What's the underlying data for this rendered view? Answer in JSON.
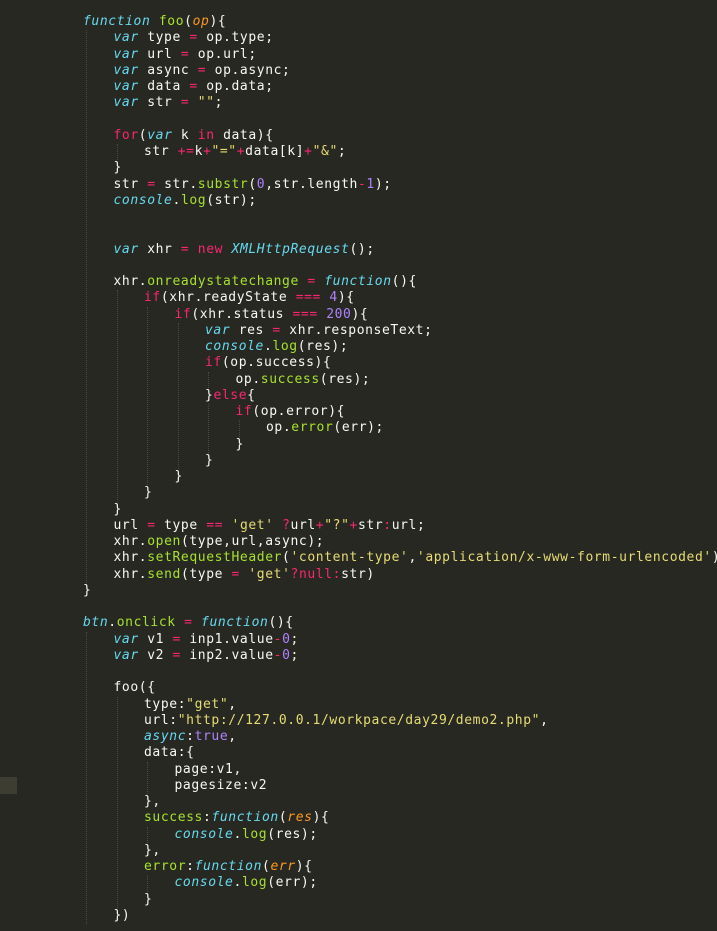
{
  "editor": {
    "theme_colors": {
      "background": "#272822",
      "text": "#f8f8f2",
      "keyword": "#f92672",
      "storage": "#66d9ef",
      "function_name": "#a6e22e",
      "number": "#ae81ff",
      "string": "#e6db74",
      "parameter": "#fd971f"
    },
    "lines": [
      [
        [
          "f",
          "function"
        ],
        [
          "p",
          " "
        ],
        [
          "n",
          "foo"
        ],
        [
          "p",
          "("
        ],
        [
          "a",
          "op"
        ],
        [
          "p",
          "){"
        ]
      ],
      [
        [
          "s",
          "var"
        ],
        [
          "p",
          " type "
        ],
        [
          "o",
          "="
        ],
        [
          "p",
          " op.type;"
        ]
      ],
      [
        [
          "s",
          "var"
        ],
        [
          "p",
          " url "
        ],
        [
          "o",
          "="
        ],
        [
          "p",
          " op.url;"
        ]
      ],
      [
        [
          "s",
          "var"
        ],
        [
          "p",
          " async "
        ],
        [
          "o",
          "="
        ],
        [
          "p",
          " op.async;"
        ]
      ],
      [
        [
          "s",
          "var"
        ],
        [
          "p",
          " data "
        ],
        [
          "o",
          "="
        ],
        [
          "p",
          " op.data;"
        ]
      ],
      [
        [
          "s",
          "var"
        ],
        [
          "p",
          " str "
        ],
        [
          "o",
          "="
        ],
        [
          "p",
          " "
        ],
        [
          "t",
          "\"\""
        ],
        [
          "p",
          ";"
        ]
      ],
      [],
      [
        [
          "k",
          "for"
        ],
        [
          "p",
          "("
        ],
        [
          "s",
          "var"
        ],
        [
          "p",
          " k "
        ],
        [
          "k",
          "in"
        ],
        [
          "p",
          " data){"
        ]
      ],
      [
        [
          "p",
          "str "
        ],
        [
          "o",
          "+="
        ],
        [
          "p",
          "k"
        ],
        [
          "o",
          "+"
        ],
        [
          "t",
          "\"=\""
        ],
        [
          "o",
          "+"
        ],
        [
          "p",
          "data[k]"
        ],
        [
          "o",
          "+"
        ],
        [
          "t",
          "\"&\""
        ],
        [
          "p",
          ";"
        ]
      ],
      [
        [
          "p",
          "}"
        ]
      ],
      [
        [
          "p",
          "str "
        ],
        [
          "o",
          "="
        ],
        [
          "p",
          " str."
        ],
        [
          "c",
          "substr"
        ],
        [
          "p",
          "("
        ],
        [
          "m",
          "0"
        ],
        [
          "p",
          ",str.length"
        ],
        [
          "o",
          "-"
        ],
        [
          "m",
          "1"
        ],
        [
          "p",
          ");"
        ]
      ],
      [
        [
          "u",
          "console"
        ],
        [
          "p",
          "."
        ],
        [
          "c",
          "log"
        ],
        [
          "p",
          "(str);"
        ]
      ],
      [],
      [],
      [
        [
          "s",
          "var"
        ],
        [
          "p",
          " xhr "
        ],
        [
          "o",
          "="
        ],
        [
          "p",
          " "
        ],
        [
          "k",
          "new"
        ],
        [
          "p",
          " "
        ],
        [
          "v",
          "XMLHttpRequest"
        ],
        [
          "p",
          "();"
        ]
      ],
      [],
      [
        [
          "p",
          "xhr."
        ],
        [
          "n",
          "onreadystatechange"
        ],
        [
          "p",
          " "
        ],
        [
          "o",
          "="
        ],
        [
          "p",
          " "
        ],
        [
          "f",
          "function"
        ],
        [
          "p",
          "(){"
        ]
      ],
      [
        [
          "k",
          "if"
        ],
        [
          "p",
          "(xhr.readyState "
        ],
        [
          "o",
          "==="
        ],
        [
          "p",
          " "
        ],
        [
          "m",
          "4"
        ],
        [
          "p",
          "){"
        ]
      ],
      [
        [
          "k",
          "if"
        ],
        [
          "p",
          "(xhr.status "
        ],
        [
          "o",
          "==="
        ],
        [
          "p",
          " "
        ],
        [
          "m",
          "200"
        ],
        [
          "p",
          "){"
        ]
      ],
      [
        [
          "s",
          "var"
        ],
        [
          "p",
          " res "
        ],
        [
          "o",
          "="
        ],
        [
          "p",
          " xhr.responseText;"
        ]
      ],
      [
        [
          "u",
          "console"
        ],
        [
          "p",
          "."
        ],
        [
          "c",
          "log"
        ],
        [
          "p",
          "(res);"
        ]
      ],
      [
        [
          "k",
          "if"
        ],
        [
          "p",
          "(op.success){"
        ]
      ],
      [
        [
          "p",
          "op."
        ],
        [
          "c",
          "success"
        ],
        [
          "p",
          "(res);"
        ]
      ],
      [
        [
          "p",
          "}"
        ],
        [
          "k",
          "else"
        ],
        [
          "p",
          "{"
        ]
      ],
      [
        [
          "k",
          "if"
        ],
        [
          "p",
          "(op.error){"
        ]
      ],
      [
        [
          "p",
          "op."
        ],
        [
          "c",
          "error"
        ],
        [
          "p",
          "(err);"
        ]
      ],
      [
        [
          "p",
          "}"
        ]
      ],
      [
        [
          "p",
          "}"
        ]
      ],
      [
        [
          "p",
          "}"
        ]
      ],
      [
        [
          "p",
          "}"
        ]
      ],
      [
        [
          "p",
          "}"
        ]
      ],
      [
        [
          "p",
          "url "
        ],
        [
          "o",
          "="
        ],
        [
          "p",
          " type "
        ],
        [
          "o",
          "=="
        ],
        [
          "p",
          " "
        ],
        [
          "t",
          "'get'"
        ],
        [
          "p",
          " "
        ],
        [
          "o",
          "?"
        ],
        [
          "p",
          "url"
        ],
        [
          "o",
          "+"
        ],
        [
          "t",
          "\"?\""
        ],
        [
          "o",
          "+"
        ],
        [
          "p",
          "str"
        ],
        [
          "o",
          ":"
        ],
        [
          "p",
          "url;"
        ]
      ],
      [
        [
          "p",
          "xhr."
        ],
        [
          "c",
          "open"
        ],
        [
          "p",
          "(type,url,async);"
        ]
      ],
      [
        [
          "p",
          "xhr."
        ],
        [
          "c",
          "setRequestHeader"
        ],
        [
          "p",
          "("
        ],
        [
          "t",
          "'content-type'"
        ],
        [
          "p",
          ","
        ],
        [
          "t",
          "'application/x-www-form-urlencoded'"
        ],
        [
          "p",
          ");"
        ]
      ],
      [
        [
          "p",
          "xhr."
        ],
        [
          "c",
          "send"
        ],
        [
          "p",
          "(type "
        ],
        [
          "o",
          "="
        ],
        [
          "p",
          " "
        ],
        [
          "t",
          "'get'"
        ],
        [
          "o",
          "?"
        ],
        [
          "k",
          "null"
        ],
        [
          "o",
          ":"
        ],
        [
          "p",
          "str)"
        ]
      ],
      [
        [
          "p",
          "}"
        ]
      ],
      [],
      [
        [
          "w",
          "btn"
        ],
        [
          "p",
          "."
        ],
        [
          "n",
          "onclick"
        ],
        [
          "p",
          " "
        ],
        [
          "o",
          "="
        ],
        [
          "p",
          " "
        ],
        [
          "f",
          "function"
        ],
        [
          "p",
          "(){"
        ]
      ],
      [
        [
          "s",
          "var"
        ],
        [
          "p",
          " v1 "
        ],
        [
          "o",
          "="
        ],
        [
          "p",
          " inp1.value"
        ],
        [
          "o",
          "-"
        ],
        [
          "m",
          "0"
        ],
        [
          "p",
          ";"
        ]
      ],
      [
        [
          "s",
          "var"
        ],
        [
          "p",
          " v2 "
        ],
        [
          "o",
          "="
        ],
        [
          "p",
          " inp2.value"
        ],
        [
          "o",
          "-"
        ],
        [
          "m",
          "0"
        ],
        [
          "p",
          ";"
        ]
      ],
      [],
      [
        [
          "p",
          "foo({"
        ]
      ],
      [
        [
          "p",
          "type:"
        ],
        [
          "t",
          "\"get\""
        ],
        [
          "p",
          ","
        ]
      ],
      [
        [
          "p",
          "url:"
        ],
        [
          "t",
          "\"http://127.0.0.1/workpace/day29/demo2.php\""
        ],
        [
          "p",
          ","
        ]
      ],
      [
        [
          "u",
          "async"
        ],
        [
          "p",
          ":"
        ],
        [
          "m",
          "true"
        ],
        [
          "p",
          ","
        ]
      ],
      [
        [
          "p",
          "data:{"
        ]
      ],
      [
        [
          "p",
          "page:v1,"
        ]
      ],
      [
        [
          "p",
          "pagesize:v2"
        ]
      ],
      [
        [
          "p",
          "},"
        ]
      ],
      [
        [
          "n",
          "success"
        ],
        [
          "p",
          ":"
        ],
        [
          "f",
          "function"
        ],
        [
          "p",
          "("
        ],
        [
          "a",
          "res"
        ],
        [
          "p",
          "){"
        ]
      ],
      [
        [
          "u",
          "console"
        ],
        [
          "p",
          "."
        ],
        [
          "c",
          "log"
        ],
        [
          "p",
          "(res);"
        ]
      ],
      [
        [
          "p",
          "},"
        ]
      ],
      [
        [
          "n",
          "error"
        ],
        [
          "p",
          ":"
        ],
        [
          "f",
          "function"
        ],
        [
          "p",
          "("
        ],
        [
          "a",
          "err"
        ],
        [
          "p",
          "){"
        ]
      ],
      [
        [
          "u",
          "console"
        ],
        [
          "p",
          "."
        ],
        [
          "c",
          "log"
        ],
        [
          "p",
          "(err);"
        ]
      ],
      [
        [
          "p",
          "}"
        ]
      ],
      [
        [
          "p",
          "})"
        ]
      ]
    ]
  }
}
